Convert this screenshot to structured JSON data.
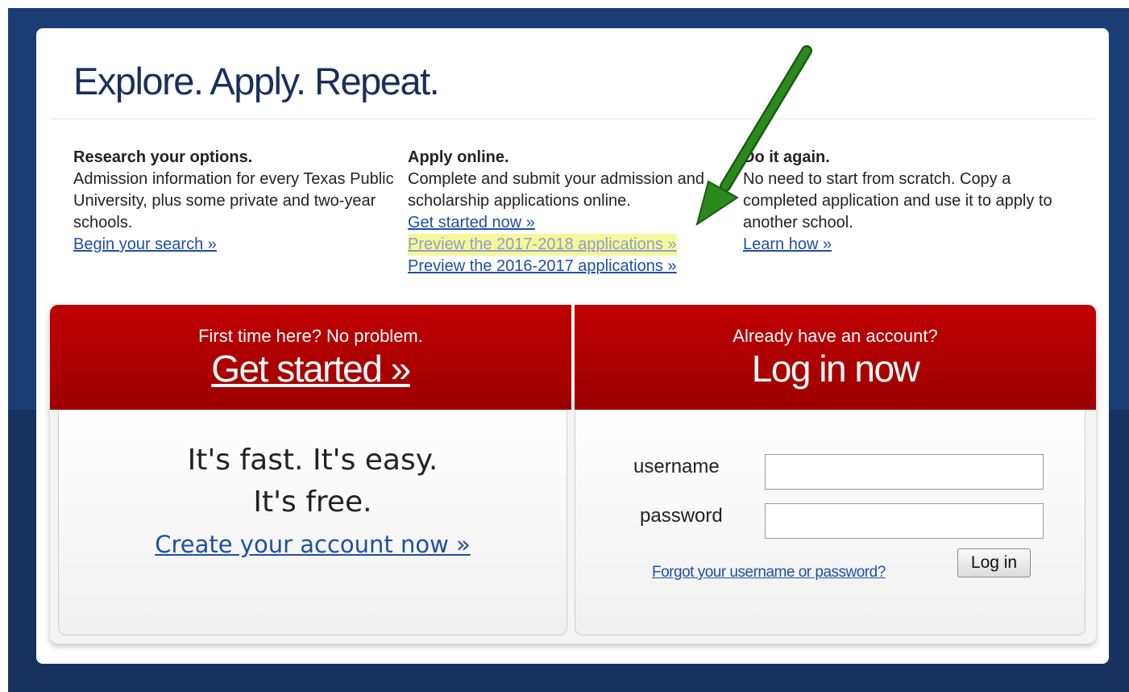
{
  "page": {
    "title": "Explore. Apply. Repeat."
  },
  "columns": [
    {
      "heading": "Research your options.",
      "text": "Admission information for every Texas Public University, plus some private and two-year schools.",
      "links": [
        "Begin your search »"
      ]
    },
    {
      "heading": "Apply online.",
      "text": "Complete and submit your admission and scholarship applications online.",
      "links": [
        "Get started now »",
        "Preview the 2017-2018 applications »",
        "Preview the 2016-2017 applications »"
      ]
    },
    {
      "heading": "Do it again.",
      "text": "No need to start from scratch. Copy a completed application and use it to apply to another school.",
      "links": [
        "Learn how »"
      ]
    }
  ],
  "annotation": {
    "arrow_color": "#2a8a1e",
    "highlight_color": "#f6f79a"
  },
  "left_panel": {
    "sub": "First time here? No problem.",
    "main_link": "Get started »",
    "tagline_1": "It's fast. It's easy.",
    "tagline_2": "It's free.",
    "create_link": "Create your account now »"
  },
  "right_panel": {
    "sub": "Already have an account?",
    "main": "Log in now",
    "username_label": "username",
    "password_label": "password",
    "username_value": "",
    "password_value": "",
    "forgot_link": "Forgot your username or password?",
    "login_button": "Log in"
  },
  "colors": {
    "header_red": "#c00000",
    "navy": "#1b3d75",
    "link": "#1f4fa3"
  }
}
